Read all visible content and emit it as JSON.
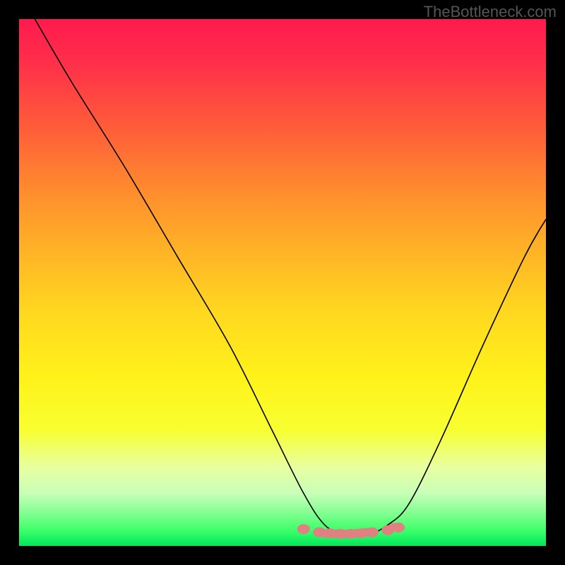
{
  "watermark": "TheBottleneck.com",
  "chart_data": {
    "type": "line",
    "title": "",
    "xlabel": "",
    "ylabel": "",
    "xlim": [
      0,
      100
    ],
    "ylim": [
      0,
      100
    ],
    "series": [
      {
        "name": "curve",
        "x": [
          3,
          10,
          20,
          30,
          40,
          48,
          54,
          58,
          62,
          66,
          70,
          74,
          80,
          88,
          96,
          100
        ],
        "y": [
          100,
          88,
          72,
          55,
          38,
          22,
          10,
          4,
          2,
          2,
          4,
          8,
          20,
          38,
          55,
          62
        ]
      },
      {
        "name": "bottom-markers",
        "x": [
          54,
          57,
          59,
          61,
          63,
          65,
          67,
          70,
          72
        ],
        "y": [
          3.2,
          2.6,
          2.4,
          2.3,
          2.3,
          2.4,
          2.6,
          3.0,
          3.5
        ]
      }
    ],
    "marker_color": "#e08080",
    "line_color": "#000000",
    "gradient_stops": [
      {
        "pos": 0,
        "color": "#ff1a4d"
      },
      {
        "pos": 50,
        "color": "#ffd000"
      },
      {
        "pos": 85,
        "color": "#f0ff80"
      },
      {
        "pos": 100,
        "color": "#00e85c"
      }
    ]
  }
}
